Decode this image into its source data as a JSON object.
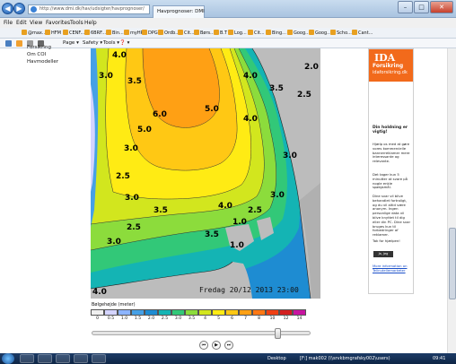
{
  "browser": {
    "address": "http://www.dmi.dk/hav/udsigter/havprognoser/",
    "tab_title": "Havprognoser: DMI",
    "nav_back": "◀",
    "nav_forward": "▶",
    "window_buttons": {
      "minimize": "–",
      "maximize": "□",
      "close": "✕"
    }
  },
  "menu": [
    "File",
    "Edit",
    "View",
    "Favorites",
    "Tools",
    "Help"
  ],
  "favorites": [
    {
      "label": "@max..."
    },
    {
      "label": "HFM"
    },
    {
      "label": "CENF..."
    },
    {
      "label": "6BRF..."
    },
    {
      "label": "Bin..."
    },
    {
      "label": "myHR"
    },
    {
      "label": "DPG"
    },
    {
      "label": "Ordb..."
    },
    {
      "label": "Cit..."
    },
    {
      "label": "Børs..."
    },
    {
      "label": "B.T"
    },
    {
      "label": "Log..."
    },
    {
      "label": "Cit..."
    },
    {
      "label": "Bing..."
    },
    {
      "label": "Goog..."
    },
    {
      "label": "Goog..."
    },
    {
      "label": "Scho..."
    },
    {
      "label": "Cant..."
    }
  ],
  "command_bar": {
    "page": "Page ▾",
    "safety": "Safety ▾",
    "tools": "Tools ▾",
    "help": "❓ ▾"
  },
  "sidebar": {
    "items": [
      "Forsikring",
      "Om COI",
      "Havmodeller"
    ]
  },
  "map": {
    "date": "Fredag 20/12 2013 23:00",
    "contour_labels": [
      "4.0",
      "3.0",
      "3.5",
      "2.0",
      "4.0",
      "3.5",
      "2.5",
      "6.0",
      "5.0",
      "5.0",
      "4.0",
      "3.0",
      "2.5",
      "3.0",
      "3.0",
      "3.5",
      "3.0",
      "4.0",
      "2.5",
      "1.0",
      "3.5",
      "2.5",
      "3.0",
      "1.0",
      "4.0"
    ]
  },
  "legend": {
    "title": "Bølgehøjde (meter)",
    "labels": [
      "0",
      "0.5",
      "1.0",
      "1.5",
      "2.0",
      "2.5",
      "3.0",
      "3.5",
      "4",
      "5",
      "6",
      "7",
      "8",
      "10",
      "12",
      "14"
    ],
    "colors": [
      "#f0f0f0",
      "#d4d4ff",
      "#8cb4ff",
      "#46a0e6",
      "#1e8cd2",
      "#14b4b4",
      "#32c878",
      "#8cdc3c",
      "#d2e61e",
      "#ffeb14",
      "#ffc814",
      "#ffa014",
      "#ff7814",
      "#f04014",
      "#d21e1e",
      "#c814a0"
    ]
  },
  "playback": {
    "prev": "⏮",
    "play": "▶",
    "next": "⏭",
    "position": 0.86
  },
  "ad": {
    "logo": "IDA",
    "brand": "Forsikring",
    "url": "idaforsikring.dk",
    "heading": "Din holdning er vigtig!",
    "p1": "Hjælp os med at gøre vores kommercielle bannerreklamer mere interessante og relevante.",
    "p2": "Det tager kun 5 minutter at svare på nogle enkle spørgsmål.",
    "p3": "Dine svar vil blive behandlet fortroligt, og du vil altid være anonym. Ingen personlige data vil blive knyttet til dig eller din PC. Dine svar bruges kun til forbedringer af reklamer.",
    "thanks": "Tak for hjælpen!",
    "button": "Ja, jeg deltager",
    "more": "More information on Tellnutellemarketer"
  },
  "taskbar": {
    "desktop": "Desktop",
    "app": "[F:] mak002 (\\\\srvkbmgrafsky002\\users)",
    "time": "09:41"
  }
}
